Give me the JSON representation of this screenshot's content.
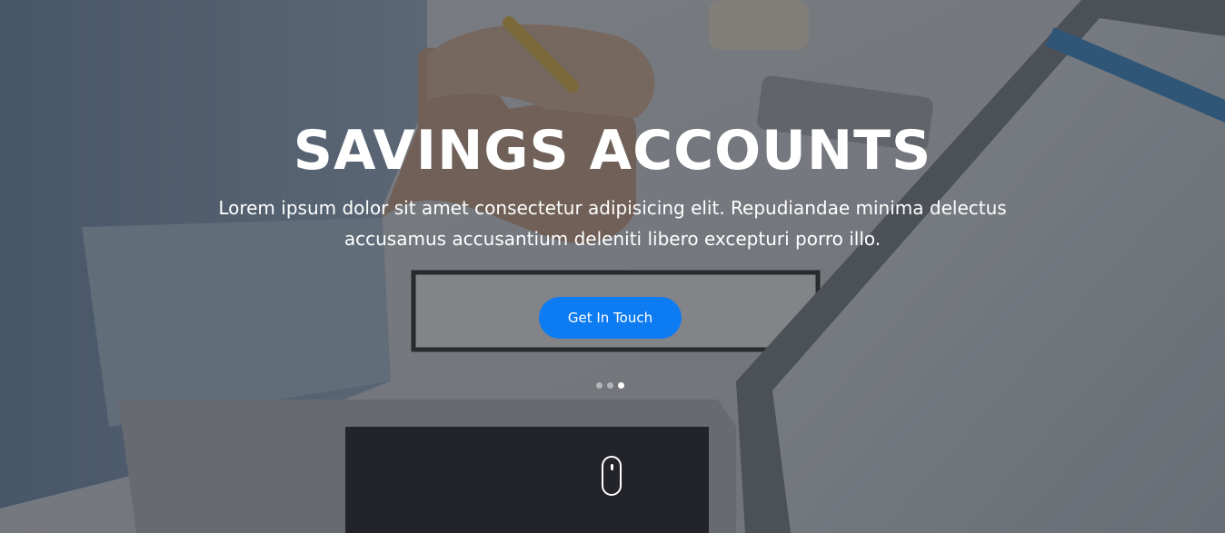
{
  "hero": {
    "title": "SAVINGS ACCOUNTS",
    "subtitle": "Lorem ipsum dolor sit amet consectetur adipisicing elit. Repudiandae minima delectus accusamus accusantium deleniti libero excepturi porro illo.",
    "cta_label": "Get In Touch",
    "slides": {
      "count": 3,
      "active_index": 2
    },
    "scroll_indicator_icon": "mouse-scroll-icon"
  },
  "colors": {
    "accent": "#0d7bf2",
    "text": "#ffffff",
    "overlay": "#26282e"
  }
}
